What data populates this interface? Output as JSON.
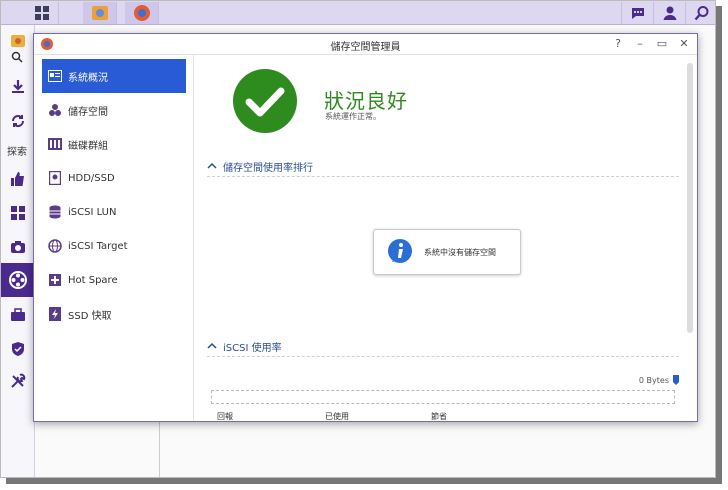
{
  "window": {
    "title": "儲存空間管理員"
  },
  "desktop": {
    "sidebar_label": "探索"
  },
  "nav": {
    "items": [
      {
        "label": "系統概況",
        "icon": "overview-icon",
        "active": true
      },
      {
        "label": "儲存空間",
        "icon": "volume-icon",
        "active": false
      },
      {
        "label": "磁碟群組",
        "icon": "disk-group-icon",
        "active": false
      },
      {
        "label": "HDD/SSD",
        "icon": "hdd-icon",
        "active": false
      },
      {
        "label": "iSCSI LUN",
        "icon": "iscsi-lun-icon",
        "active": false
      },
      {
        "label": "iSCSI Target",
        "icon": "iscsi-target-icon",
        "active": false
      },
      {
        "label": "Hot Spare",
        "icon": "hot-spare-icon",
        "active": false
      },
      {
        "label": "SSD 快取",
        "icon": "ssd-cache-icon",
        "active": false
      }
    ]
  },
  "status": {
    "title": "狀況良好",
    "subtitle": "系統運作正常。"
  },
  "sections": {
    "volume_usage": "儲存空間使用率排行",
    "iscsi_usage": "iSCSI 使用率"
  },
  "empty_message": "系統中沒有儲存空間",
  "iscsi": {
    "bytes": "0 Bytes",
    "legend": [
      "回報",
      "已使用",
      "節省"
    ]
  },
  "colors": {
    "accent": "#2a5bd7",
    "status_ok": "#2e8b1e",
    "taskbar": "#ddd8ef",
    "active_desktop_item": "#4b2a8f"
  }
}
